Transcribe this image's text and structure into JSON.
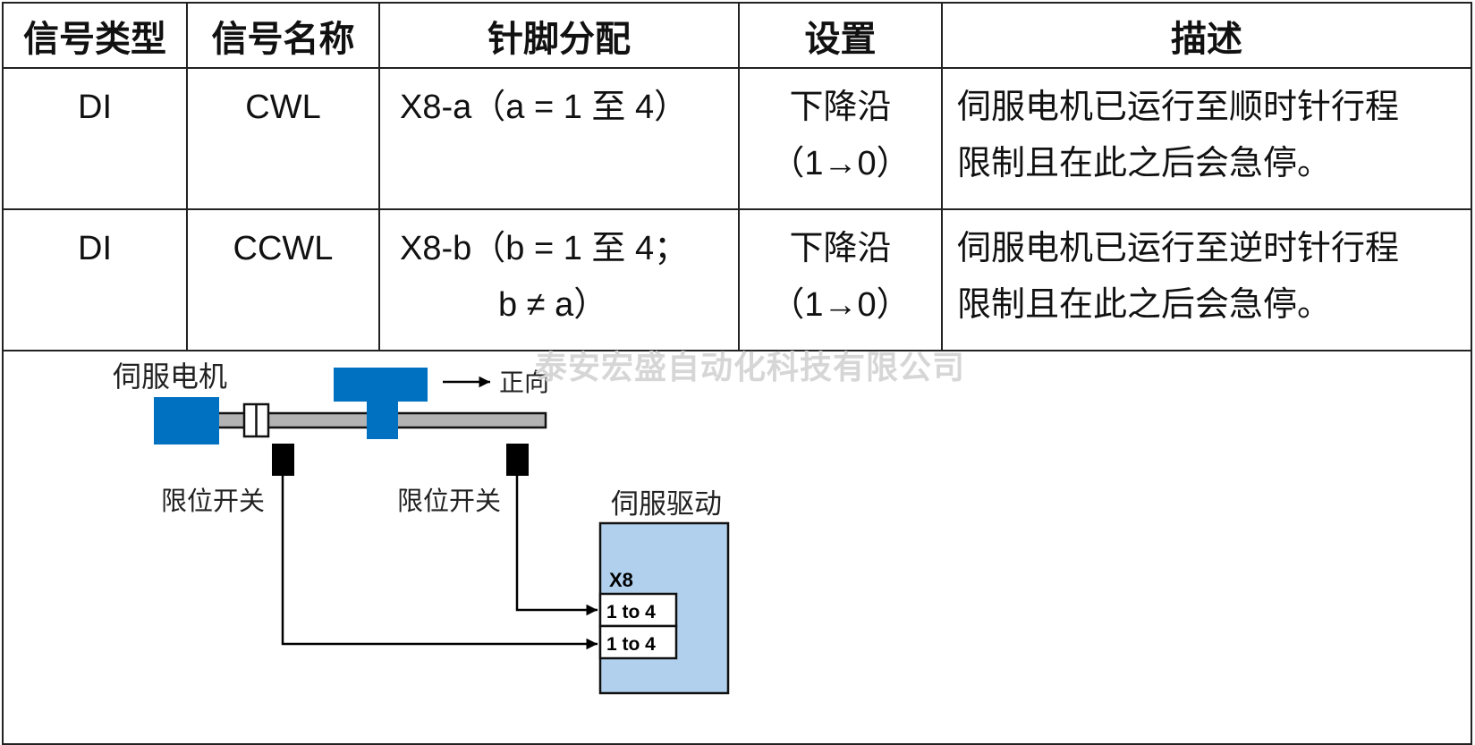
{
  "table": {
    "headers": [
      "信号类型",
      "信号名称",
      "针脚分配",
      "设置",
      "描述"
    ],
    "rows": [
      {
        "signal_type": "DI",
        "signal_name": "CWL",
        "pin_line1": "X8-a（a = 1 至 4）",
        "pin_line2": "",
        "setting_line1": "下降沿",
        "setting_line2": "（1→0）",
        "desc_line1": "伺服电机已运行至顺时针行程",
        "desc_line2": "限制且在此之后会急停。"
      },
      {
        "signal_type": "DI",
        "signal_name": "CCWL",
        "pin_line1": "X8-b（b = 1 至 4；",
        "pin_line2": "b ≠ a）",
        "setting_line1": "下降沿",
        "setting_line2": "（1→0）",
        "desc_line1": "伺服电机已运行至逆时针行程",
        "desc_line2": "限制且在此之后会急停。"
      }
    ]
  },
  "diagram": {
    "motor_label": "伺服电机",
    "direction_label": "正向",
    "limit_switch_left_label": "限位开关",
    "limit_switch_right_label": "限位开关",
    "drive_label": "伺服驱动",
    "connector_label": "X8",
    "pin_slot_1": "1 to 4",
    "pin_slot_2": "1 to 4",
    "colors": {
      "motor_blue": "#0070C0",
      "drive_fill": "#B0D0EE",
      "shaft_gray": "#B3B3B3"
    }
  },
  "watermark": "泰安宏盛自动化科技有限公司"
}
